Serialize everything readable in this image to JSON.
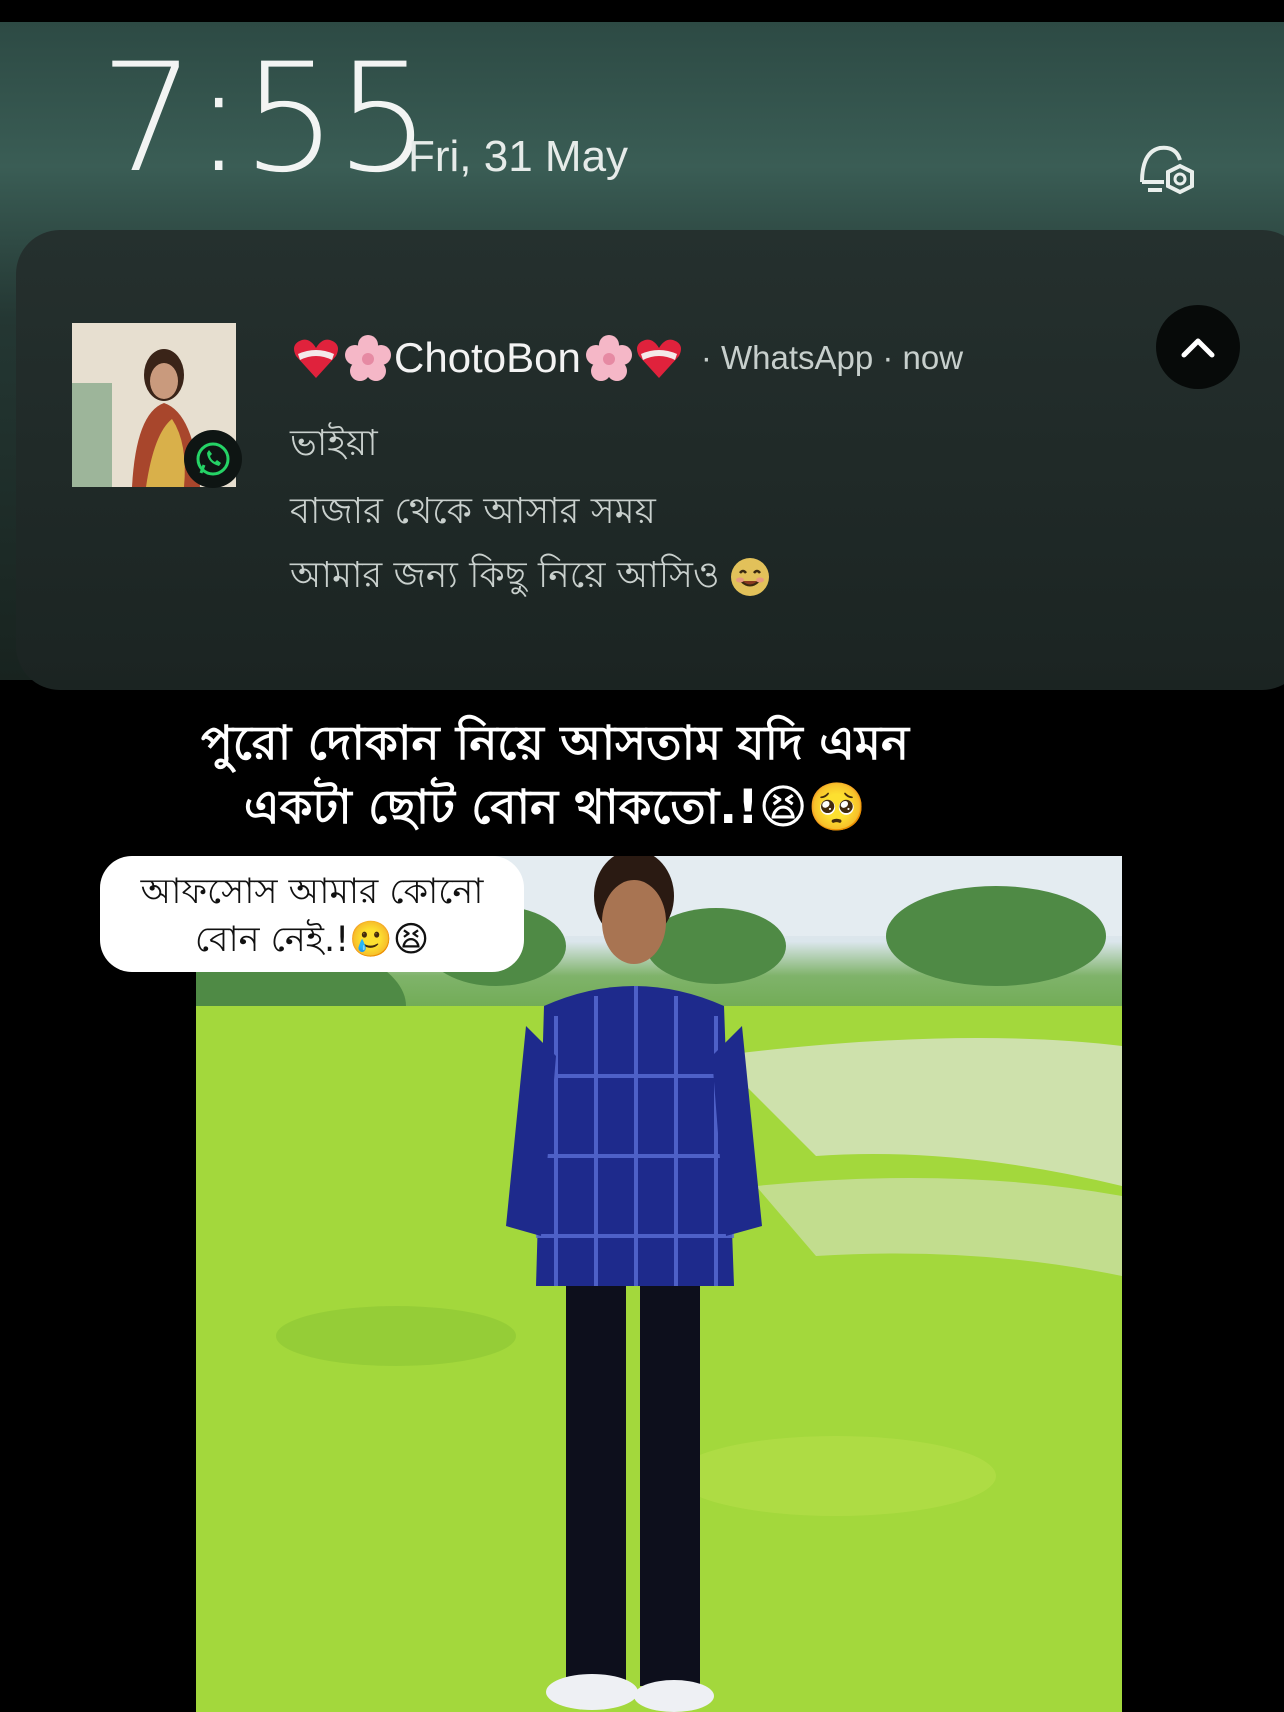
{
  "lockscreen": {
    "time": "7:55",
    "date": "Fri, 31 May"
  },
  "notification": {
    "sender_name": "ChotoBon",
    "app": "· WhatsApp · now",
    "messages": [
      "ভাইয়া",
      "বাজার থেকে আসার সময়",
      "আমার জন্য কিছু নিয়ে আসিও"
    ]
  },
  "caption": {
    "line1": "পুরো দোকান নিয়ে আসতাম যদি এমন",
    "line2": "একটা ছোট বোন থাকতো.!😫🥺"
  },
  "bubble": {
    "line1": "আফসোস আমার কোনো",
    "line2": "বোন নেই.!🥲😫"
  },
  "colors": {
    "lock_bg": "#2d4a44",
    "card_bg": "#1b2422",
    "whatsapp_green": "#25d366",
    "photo_grass": "#a9dc3e"
  }
}
